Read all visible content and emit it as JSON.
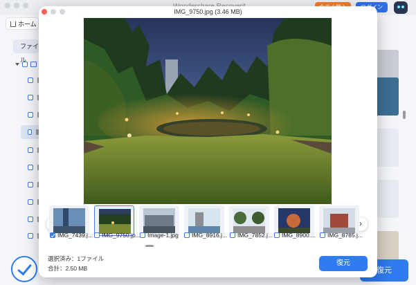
{
  "background": {
    "app_title": "Wondershare Recoverit",
    "orange_button": "今すぐ購入",
    "login_button": "ログイン",
    "home_tab": "ホーム",
    "sidebar_file_label": "ファイル",
    "bottom_button": "復元"
  },
  "modal": {
    "title": "IMG_9750.jpg (3.46 MB)",
    "prev_arrow": "‹",
    "next_arrow": "›",
    "thumbnails": [
      {
        "label": "IMG_7439.j...",
        "checked": true,
        "selected": false
      },
      {
        "label": "IMG_9750.jp...",
        "checked": false,
        "selected": true
      },
      {
        "label": "Image-1.jpg",
        "checked": false,
        "selected": false
      },
      {
        "label": "IMG_8916.j...",
        "checked": false,
        "selected": false
      },
      {
        "label": "IMG_7852.j...",
        "checked": false,
        "selected": false
      },
      {
        "label": "IMG_8900....",
        "checked": false,
        "selected": false
      },
      {
        "label": "IMG_8785.j...",
        "checked": false,
        "selected": false
      }
    ],
    "summary": {
      "selected": "選択済み：1ファイル",
      "total": "合計：2.50 MB"
    },
    "restore_button": "復元"
  },
  "colors": {
    "accent": "#2f7bf0",
    "orange": "#f57c2a"
  }
}
